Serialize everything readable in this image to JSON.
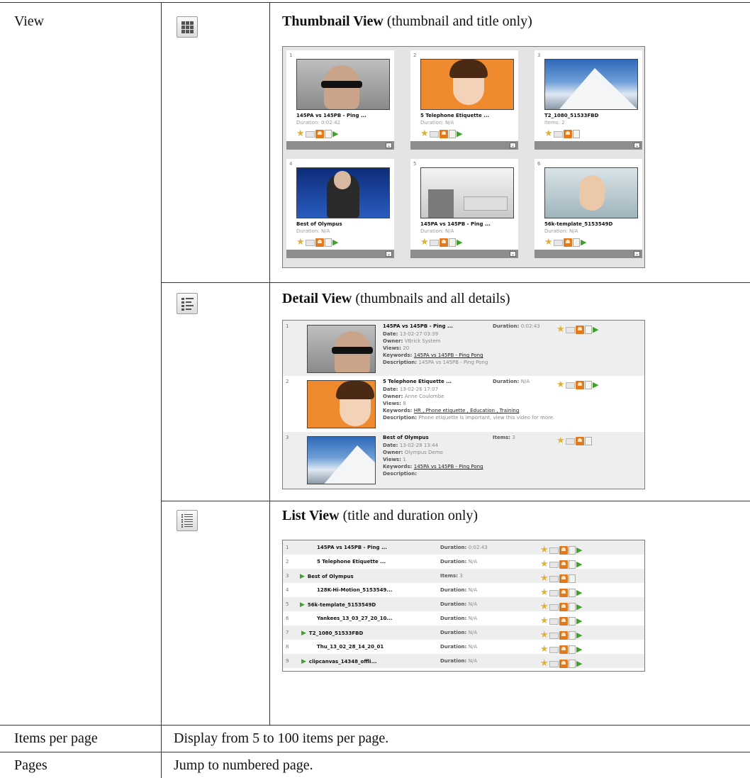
{
  "rows": {
    "view": {
      "label": "View"
    },
    "items_per_page": {
      "label": "Items per page",
      "desc": "Display from 5 to 100 items per page."
    },
    "pages": {
      "label": "Pages",
      "desc": "Jump to numbered page."
    }
  },
  "views": {
    "thumbnail": {
      "name": "Thumbnail View",
      "note": "(thumbnail and title only)",
      "icon": "grid-view-icon"
    },
    "detail": {
      "name": "Detail View",
      "note": "(thumbnails and all details)",
      "icon": "detail-view-icon"
    },
    "list": {
      "name": "List View",
      "note": "(title and duration only)",
      "icon": "list-view-icon"
    }
  },
  "thumbnail_items": [
    {
      "num": "1",
      "title": "145PA vs 145PB - Ping ...",
      "meta": "Duration: 0:02:42"
    },
    {
      "num": "2",
      "title": "5 Telephone Etiquette ...",
      "meta": "Duration: N/A"
    },
    {
      "num": "3",
      "title": "T2_1080_51533FBD",
      "meta": "Items: 2"
    },
    {
      "num": "4",
      "title": "Best of Olympus",
      "meta": "Duration: N/A"
    },
    {
      "num": "5",
      "title": "145PA vs 145PB - Ping ...",
      "meta": "Duration: N/A"
    },
    {
      "num": "6",
      "title": "56k-template_5153549D",
      "meta": "Duration: N/A"
    }
  ],
  "detail_items": [
    {
      "num": "1",
      "title": "145PA vs 145PB - Ping ...",
      "duration": "0:02:43",
      "date": "13-02-27 03:39",
      "owner": "VBrick System",
      "views": "20",
      "keywords": "145PA vs 145PB - Ping Pong",
      "description": "145PA vs 145PB - Ping Pong",
      "dur_label": "Duration:"
    },
    {
      "num": "2",
      "title": "5 Telephone Etiquette ...",
      "duration": "N/A",
      "date": "13-02-26 17:07",
      "owner": "Anne Coulombe",
      "views": "8",
      "keywords": "HR , Phone etiquette , Education , Training",
      "description": "Phone etiquette is important, view this video for more.",
      "dur_label": "Duration:"
    },
    {
      "num": "3",
      "title": "Best of Olympus",
      "duration": "3",
      "date": "13-02-28 13:44",
      "owner": "Olympus Demo",
      "views": "1",
      "keywords": "145PA vs 145PB - Ping Pong",
      "description": "",
      "dur_label": "Items:"
    }
  ],
  "detail_labels": {
    "date": "Date:",
    "owner": "Owner:",
    "views": "Views:",
    "keywords": "Keywords:",
    "description": "Description:"
  },
  "list_items": [
    {
      "num": "1",
      "title": "145PA vs 145PB - Ping ...",
      "dur_label": "Duration:",
      "dur": "0:02:43",
      "play": false
    },
    {
      "num": "2",
      "title": "5 Telephone Etiquette ...",
      "dur_label": "Duration:",
      "dur": "N/A",
      "play": false
    },
    {
      "num": "3",
      "title": "Best of Olympus",
      "dur_label": "Items:",
      "dur": "3",
      "play": true
    },
    {
      "num": "4",
      "title": "128K-Hi-Motion_5153549...",
      "dur_label": "Duration:",
      "dur": "N/A",
      "play": false
    },
    {
      "num": "5",
      "title": "56k-template_5153549D",
      "dur_label": "Duration:",
      "dur": "N/A",
      "play": true
    },
    {
      "num": "6",
      "title": "Yankees_13_03_27_20_10...",
      "dur_label": "Duration:",
      "dur": "N/A",
      "play": false
    },
    {
      "num": "7",
      "title": "T2_1080_51533FBD",
      "dur_label": "Duration:",
      "dur": "N/A",
      "play": true
    },
    {
      "num": "8",
      "title": "Thu_13_02_28_14_20_01",
      "dur_label": "Duration:",
      "dur": "N/A",
      "play": false
    },
    {
      "num": "9",
      "title": "clipcanvas_14348_offli...",
      "dur_label": "Duration:",
      "dur": "N/A",
      "play": true
    }
  ],
  "colors": {
    "border": "#333333",
    "panel_bg": "#e4e4e4",
    "star": "#e0b13a",
    "owner_orange": "#e2791c",
    "play_green": "#3ea22a"
  }
}
